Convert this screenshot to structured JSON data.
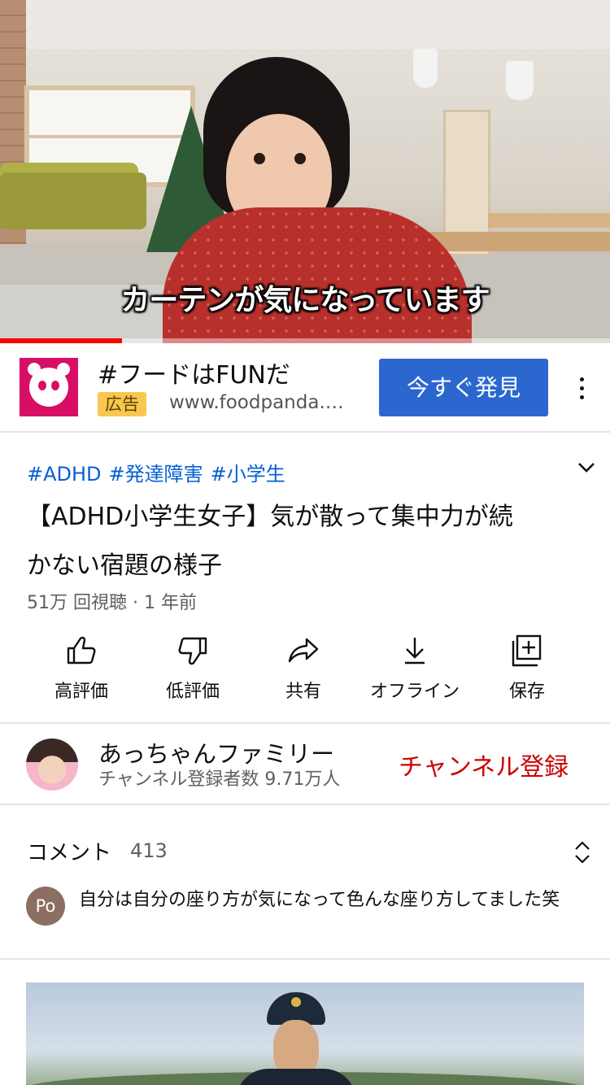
{
  "video": {
    "subtitle": "カーテンが気になっています",
    "progress": 0.2
  },
  "ad": {
    "title": "#フードはFUNだ",
    "badge": "広告",
    "url": "www.foodpanda.…",
    "cta": "今すぐ発見",
    "brand_color": "#d70f64",
    "cta_color": "#2c67d0"
  },
  "info": {
    "hashtags": [
      "#ADHD",
      "#発達障害",
      "#小学生"
    ],
    "title_line1": "【ADHD小学生女子】気が散って集中力が続",
    "title_line2": "かない宿題の様子",
    "meta": "51万 回視聴 · 1 年前"
  },
  "actions": {
    "like": "高評価",
    "dislike": "低評価",
    "share": "共有",
    "offline": "オフライン",
    "save": "保存"
  },
  "channel": {
    "name": "あっちゃんファミリー",
    "subscribers": "チャンネル登録者数 9.71万人",
    "subscribe": "チャンネル登録",
    "subscribe_color": "#cc0000"
  },
  "comments": {
    "heading": "コメント",
    "count": "413",
    "first": {
      "avatar_initials": "Po",
      "text": "自分は自分の座り方が気になって色んな座り方してました笑"
    }
  }
}
